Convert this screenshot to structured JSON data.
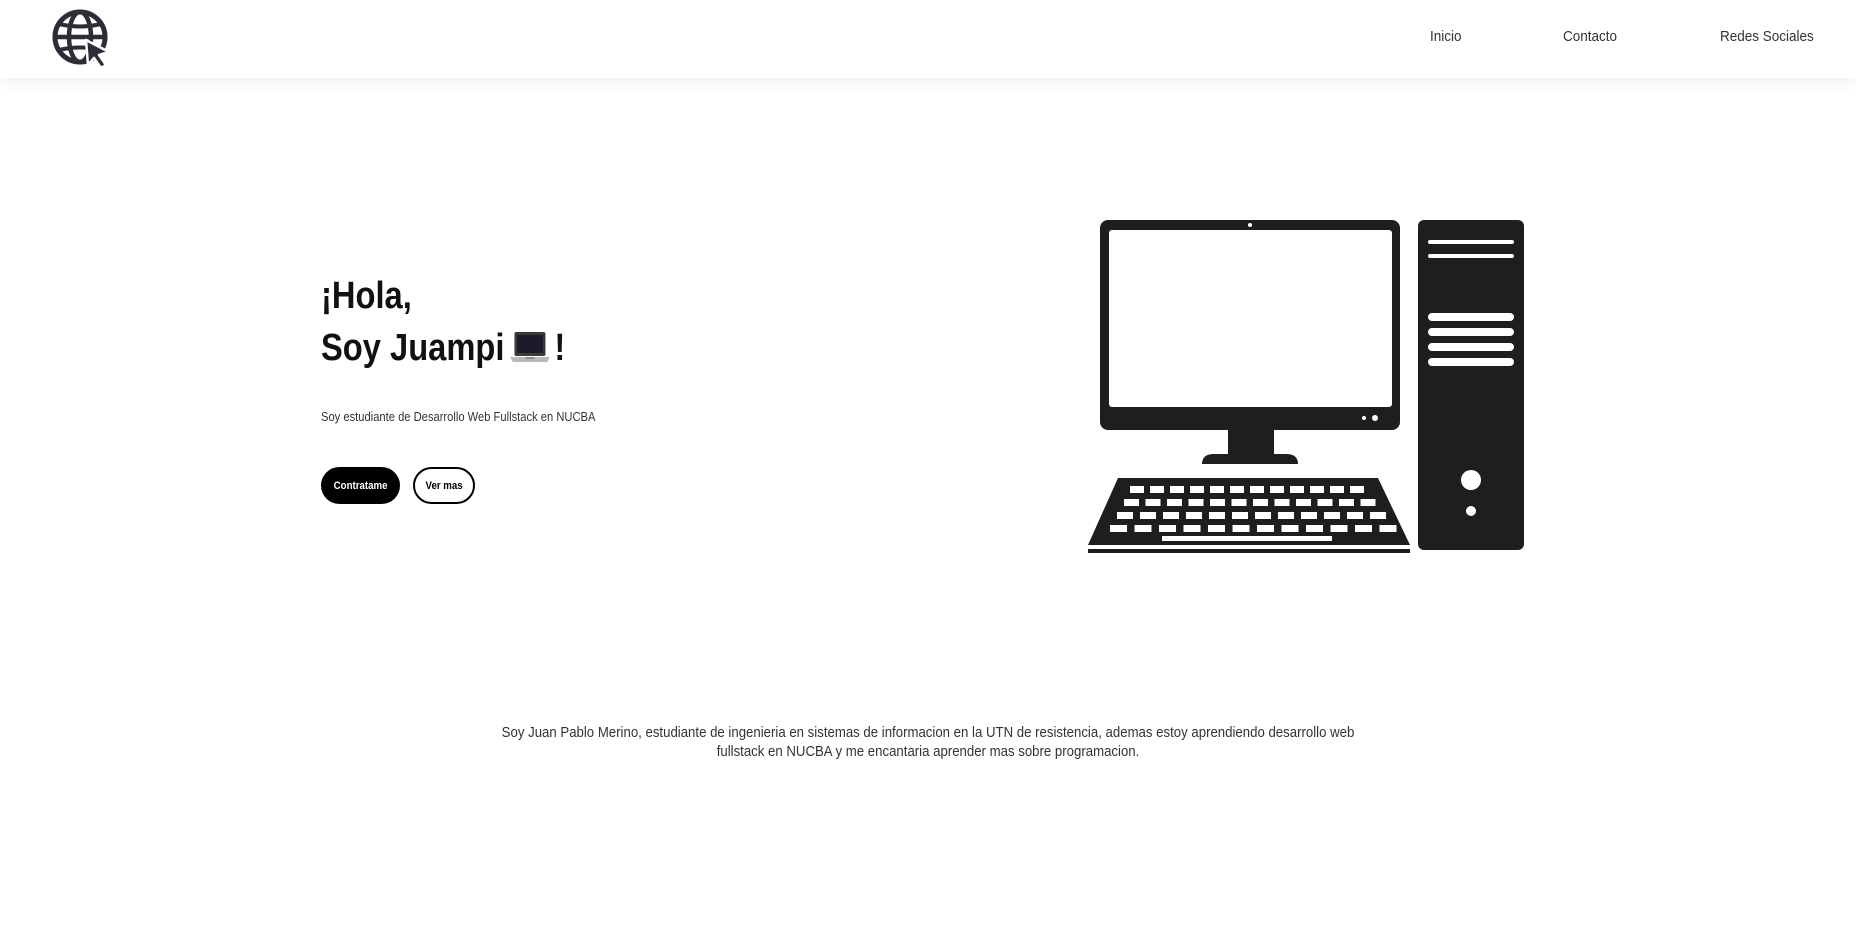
{
  "nav": {
    "links": [
      {
        "label": "Inicio"
      },
      {
        "label": "Contacto"
      },
      {
        "label": "Redes Sociales"
      }
    ]
  },
  "hero": {
    "title_line1": "¡Hola,",
    "title_line2_start": "Soy Juampi",
    "title_line2_end": "!",
    "subtitle": "Soy estudiante de Desarrollo Web Fullstack en NUCBA",
    "buttons": {
      "primary_label": "Contratame",
      "secondary_label": "Ver mas"
    }
  },
  "about": {
    "text": "Soy Juan Pablo Merino, estudiante de ingenieria en sistemas de informacion en la UTN de resistencia, ademas estoy aprendiendo desarrollo web fullstack en NUCBA y me encantaria aprender mas sobre programacion."
  },
  "icons": {
    "logo": "globe-cursor-icon",
    "title_emoji": "laptop-icon",
    "illustration": "desktop-computer-illustration"
  },
  "colors": {
    "background": "#ffffff",
    "text": "#111111",
    "illustration": "#1e1e1e",
    "button_primary_bg": "#000000",
    "button_primary_text": "#ffffff"
  }
}
